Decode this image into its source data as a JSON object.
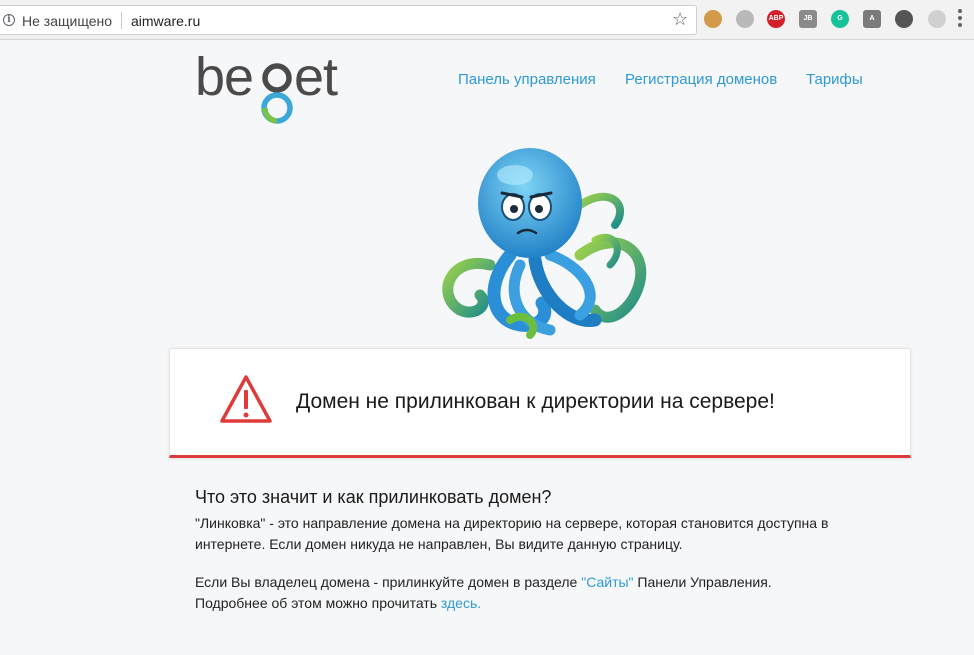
{
  "browser": {
    "security_text": "Не защищено",
    "url": "aimware.ru",
    "extensions": [
      {
        "name": "cookie-icon",
        "color": "#d39b49",
        "label": ""
      },
      {
        "name": "globe-icon",
        "color": "#b9b9b9",
        "label": ""
      },
      {
        "name": "adblock-plus-icon",
        "color": "#d3202b",
        "label": "ABP"
      },
      {
        "name": "jb-icon",
        "color": "#8a8a8a",
        "label": "JB"
      },
      {
        "name": "grammarly-icon",
        "color": "#15c39a",
        "label": "G"
      },
      {
        "name": "angular-icon",
        "color": "#7a7a7a",
        "label": "A"
      },
      {
        "name": "sync-icon",
        "color": "#555555",
        "label": ""
      },
      {
        "name": "gear-extension-icon",
        "color": "#d0d0d0",
        "label": ""
      }
    ]
  },
  "header": {
    "logo_text": "beget",
    "nav": [
      {
        "label": "Панель управления"
      },
      {
        "label": "Регистрация доменов"
      },
      {
        "label": "Тарифы"
      }
    ]
  },
  "alert": {
    "message": "Домен не прилинкован к директории на сервере!",
    "accent_color": "#e03b3b"
  },
  "info": {
    "title": "Что это значит и как прилинковать домен?",
    "p1": "\"Линковка\" - это направление домена на директорию на сервере, которая становится доступна в интернете. Если домен никуда не направлен, Вы видите данную страницу.",
    "p2_before": "Если Вы владелец домена - прилинкуйте домен в разделе ",
    "p2_link": "\"Сайты\"",
    "p2_after": " Панели Управления.",
    "p3_before": "Подробнее об этом можно прочитать ",
    "p3_link": "здесь."
  },
  "colors": {
    "link": "#2f9ad6",
    "alert_border": "#e03b3b",
    "background": "#f6f7f9"
  }
}
